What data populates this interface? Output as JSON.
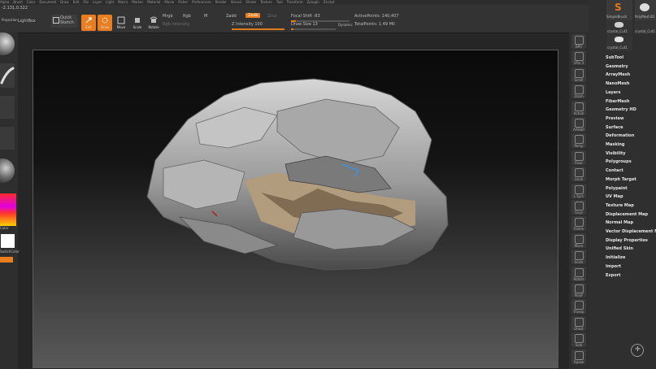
{
  "menu": [
    "Alpha",
    "Brush",
    "Color",
    "Document",
    "Draw",
    "Edit",
    "File",
    "Layer",
    "Light",
    "Macro",
    "Marker",
    "Material",
    "Movie",
    "Picker",
    "Preferences",
    "Render",
    "Stencil",
    "Stroke",
    "Texture",
    "Tool",
    "Transform",
    "Zplugin",
    "Zscript"
  ],
  "toolbar": {
    "coords": "-2.131,0.322",
    "projection": "Projection",
    "lightbox": "LightBox",
    "quicksketch_1": "Quick",
    "quicksketch_2": "Sketch",
    "edit": "Edit",
    "draw": "Draw",
    "move": "Move",
    "scale": "Scale",
    "rotate": "Rotate",
    "mrgb": "Mrgb",
    "rgb": "Rgb",
    "m": "M",
    "rgb_intensity": "Rgb Intensity",
    "zadd": "Zadd",
    "zsub": "Zsub",
    "zcut": "Zcut",
    "z_intensity": "Z Intensity 100",
    "focal_shift": "Focal Shift -83",
    "draw_size": "Draw Size 13",
    "dynamic": "Dynamic",
    "active_points": "ActivePoints: 140,407",
    "total_points": "TotalPoints: 1.49 Mil",
    "z_intensity_level": 1.0,
    "focal_shift_level": 0.0,
    "draw_size_level": 0.05
  },
  "left_shelf": {
    "color_label": "Color",
    "swatch_label": "SwitchColor"
  },
  "right_shelf": [
    {
      "name": "bpr-button",
      "label": "BPR"
    },
    {
      "name": "spix-button",
      "label": "SPix 3"
    },
    {
      "name": "scroll-button",
      "label": "Scroll"
    },
    {
      "name": "zoom-button",
      "label": "Zoom"
    },
    {
      "name": "actual-button",
      "label": "Actual"
    },
    {
      "name": "aahalf-button",
      "label": "AAHalf"
    },
    {
      "name": "persp-button",
      "label": "Persp"
    },
    {
      "name": "floor-button",
      "label": "Floor"
    },
    {
      "name": "local-button",
      "label": "Local"
    },
    {
      "name": "lsym-button",
      "label": "L.Sym"
    },
    {
      "name": "xyz-button",
      "label": "Gxyz"
    },
    {
      "name": "frame-button",
      "label": "Frame"
    },
    {
      "name": "move-button",
      "label": "Move"
    },
    {
      "name": "scale-button",
      "label": "Scale"
    },
    {
      "name": "rotate-button",
      "label": "Rotate"
    },
    {
      "name": "polyf-button",
      "label": "PolyF"
    },
    {
      "name": "transp-button",
      "label": "Transp"
    },
    {
      "name": "ghost-button",
      "label": "Ghost"
    },
    {
      "name": "solo-button",
      "label": "Solo"
    },
    {
      "name": "xpose-button",
      "label": "Xpose"
    }
  ],
  "tray": {
    "thumb1": "SimpleBrush",
    "thumb2": "PolyMesh3D",
    "thumb3": "crystal_Cut1",
    "thumb4": "crystal_Cut1",
    "thumb5": "crystal_Cut1",
    "items": [
      "SubTool",
      "Geometry",
      "ArrayMesh",
      "NanoMesh",
      "Layers",
      "FiberMesh",
      "Geometry HD",
      "Preview",
      "Surface",
      "Deformation",
      "Masking",
      "Visibility",
      "Polygroups",
      "Contact",
      "Morph Target",
      "Polypaint",
      "UV Map",
      "Texture Map",
      "Displacement Map",
      "Normal Map",
      "Vector Displacement Map",
      "Display Properties",
      "Unified Skin",
      "Initialize",
      "Import",
      "Export"
    ]
  },
  "colors": {
    "accent": "#ea7d1e",
    "panel": "#333333",
    "canvas_top": "#0a0a0a",
    "canvas_bottom": "#595959"
  }
}
